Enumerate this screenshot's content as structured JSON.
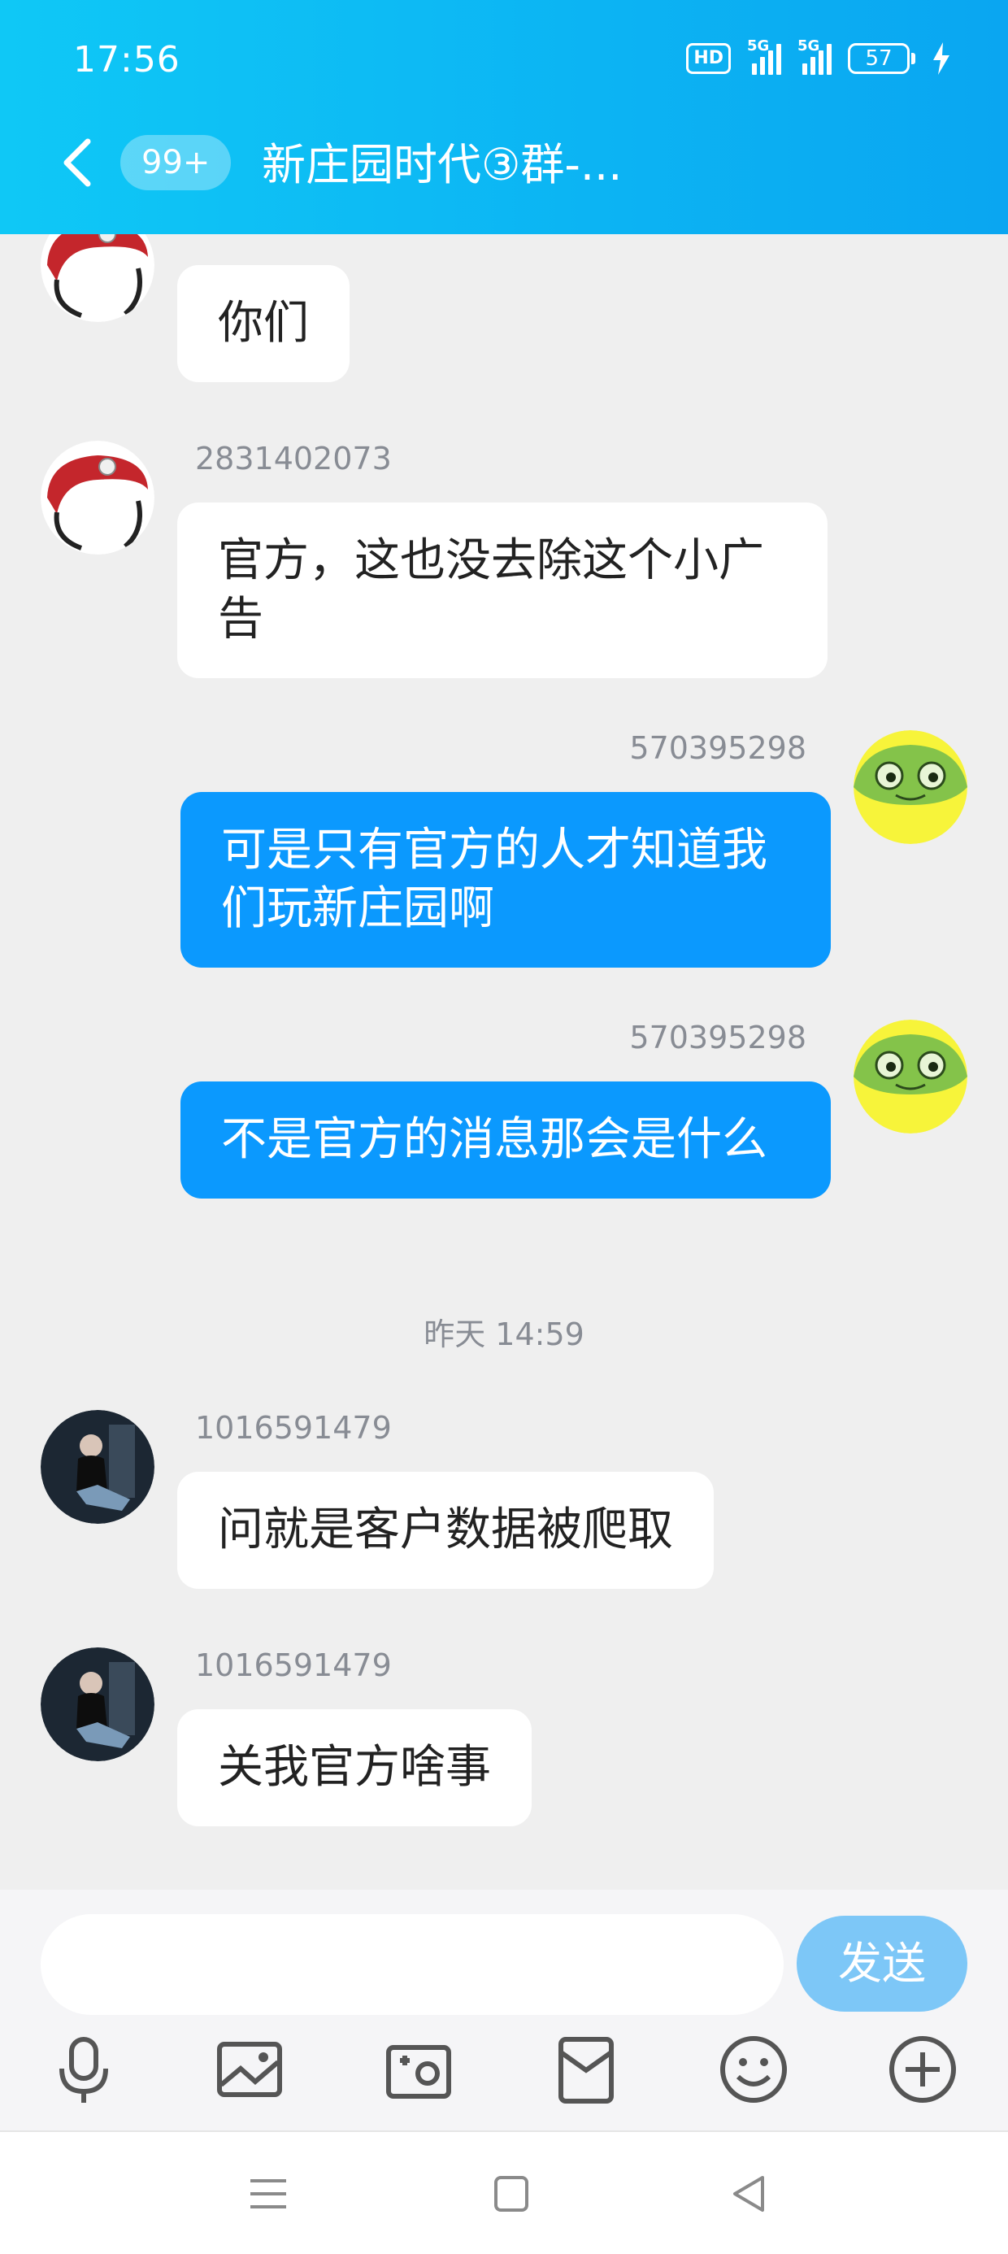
{
  "status_bar": {
    "time": "17:56",
    "hd_label": "HD",
    "signal1_label": "5G",
    "signal2_label": "5G",
    "battery": "57"
  },
  "header": {
    "unread_badge": "99+",
    "title": "新庄园时代③群-..."
  },
  "messages": [
    {
      "side": "in",
      "nickname": "",
      "text": "你们",
      "avatar": "red-beret-avatar"
    },
    {
      "side": "in",
      "nickname": "2831402073",
      "text": "官方，这也没去除这个小广告",
      "avatar": "red-beret-avatar"
    },
    {
      "side": "out",
      "nickname": "570395298",
      "text": "可是只有官方的人才知道我们玩新庄园啊",
      "avatar": "frog-avatar"
    },
    {
      "side": "out",
      "nickname": "570395298",
      "text": "不是官方的消息那会是什么",
      "avatar": "frog-avatar"
    },
    {
      "side": "time",
      "text": "昨天 14:59"
    },
    {
      "side": "in",
      "nickname": "1016591479",
      "text": "问就是客户数据被爬取",
      "avatar": "photo-avatar"
    },
    {
      "side": "in",
      "nickname": "1016591479",
      "text": "关我官方啥事",
      "avatar": "photo-avatar"
    }
  ],
  "input": {
    "placeholder": "",
    "send_label": "发送"
  },
  "toolbar": [
    "mic-icon",
    "image-icon",
    "camera-icon",
    "red-packet-icon",
    "emoji-icon",
    "plus-icon"
  ],
  "colors": {
    "header_start": "#0fc8f6",
    "header_end": "#0aa6f1",
    "out_bubble": "#0b99fe",
    "in_bubble": "#ffffff",
    "send_button": "#7dc7f7"
  }
}
